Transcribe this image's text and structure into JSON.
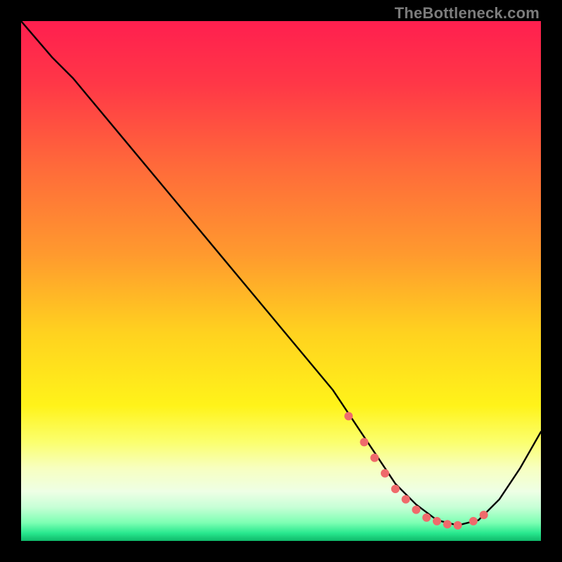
{
  "watermark": {
    "text": "TheBottleneck.com"
  },
  "chart_data": {
    "type": "line",
    "title": "",
    "xlabel": "",
    "ylabel": "",
    "xlim": [
      0,
      100
    ],
    "ylim": [
      0,
      100
    ],
    "legend": false,
    "grid": false,
    "background_gradient": {
      "stops": [
        {
          "pos": 0.0,
          "color": "#ff1f4f"
        },
        {
          "pos": 0.12,
          "color": "#ff3747"
        },
        {
          "pos": 0.28,
          "color": "#ff6a3a"
        },
        {
          "pos": 0.45,
          "color": "#ff9a2e"
        },
        {
          "pos": 0.6,
          "color": "#ffd21f"
        },
        {
          "pos": 0.74,
          "color": "#fff31a"
        },
        {
          "pos": 0.81,
          "color": "#fbff6e"
        },
        {
          "pos": 0.86,
          "color": "#f7ffc0"
        },
        {
          "pos": 0.905,
          "color": "#eeffe5"
        },
        {
          "pos": 0.935,
          "color": "#c7ffd6"
        },
        {
          "pos": 0.965,
          "color": "#7dffb3"
        },
        {
          "pos": 0.985,
          "color": "#28e88e"
        },
        {
          "pos": 1.0,
          "color": "#0fb96a"
        }
      ]
    },
    "series": [
      {
        "name": "bottleneck-curve",
        "color": "#000000",
        "x": [
          0,
          6,
          10,
          20,
          30,
          40,
          50,
          60,
          64,
          68,
          72,
          76,
          80,
          84,
          86,
          88,
          92,
          96,
          100
        ],
        "y": [
          100,
          93,
          89,
          77,
          65,
          53,
          41,
          29,
          23,
          17,
          11,
          7,
          4,
          3,
          3.5,
          4,
          8,
          14,
          21
        ]
      }
    ],
    "markers": {
      "name": "highlight-dots",
      "color": "#ef6a6b",
      "radius": 6,
      "x": [
        63,
        66,
        68,
        70,
        72,
        74,
        76,
        78,
        80,
        82,
        84,
        87,
        89
      ],
      "y": [
        24,
        19,
        16,
        13,
        10,
        8,
        6,
        4.5,
        3.8,
        3.2,
        3.0,
        3.8,
        5.0
      ]
    }
  }
}
